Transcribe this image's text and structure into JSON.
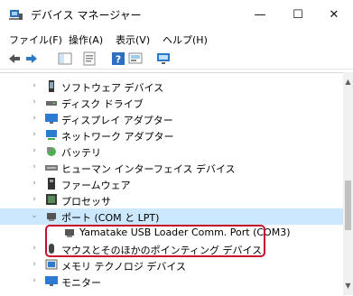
{
  "window": {
    "title": "デバイス マネージャー",
    "minimize": "—",
    "maximize": "☐",
    "close": "✕"
  },
  "menu": [
    "ファイル(F)",
    "操作(A)",
    "表示(V)",
    "ヘルプ(H)"
  ],
  "tree": [
    {
      "label": "ソフトウェア デバイス",
      "chev": "›",
      "icon": "software-device-icon"
    },
    {
      "label": "ディスク ドライブ",
      "chev": "›",
      "icon": "disk-drive-icon"
    },
    {
      "label": "ディスプレイ アダプター",
      "chev": "›",
      "icon": "display-adapter-icon"
    },
    {
      "label": "ネットワーク アダプター",
      "chev": "›",
      "icon": "network-adapter-icon"
    },
    {
      "label": "バッテリ",
      "chev": "›",
      "icon": "battery-icon"
    },
    {
      "label": "ヒューマン インターフェイス デバイス",
      "chev": "›",
      "icon": "hid-icon"
    },
    {
      "label": "ファームウェア",
      "chev": "›",
      "icon": "firmware-icon"
    },
    {
      "label": "プロセッサ",
      "chev": "›",
      "icon": "processor-icon"
    },
    {
      "label": "ポート (COM と LPT)",
      "chev": "⌄",
      "icon": "port-icon"
    },
    {
      "label": "Yamatake USB Loader Comm. Port (COM3)",
      "chev": "",
      "icon": "port-device-icon"
    },
    {
      "label": "マウスとそのほかのポインティング デバイス",
      "chev": "›",
      "icon": "mouse-icon"
    },
    {
      "label": "メモリ テクノロジ デバイス",
      "chev": "›",
      "icon": "memory-icon"
    },
    {
      "label": "モニター",
      "chev": "›",
      "icon": "monitor-icon"
    }
  ]
}
